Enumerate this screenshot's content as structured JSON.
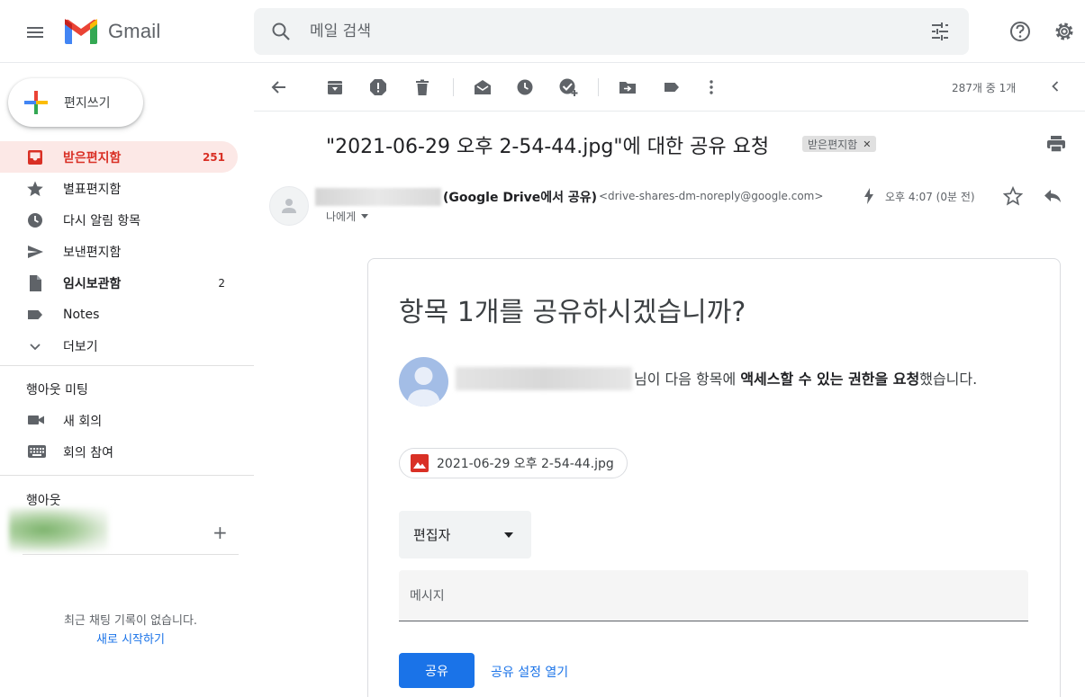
{
  "app": {
    "name": "Gmail"
  },
  "search": {
    "placeholder": "메일 검색"
  },
  "compose": {
    "label": "편지쓰기"
  },
  "sidebar": {
    "items": [
      {
        "label": "받은편지함",
        "count": "251",
        "icon": "inbox-icon"
      },
      {
        "label": "별표편지함",
        "count": "",
        "icon": "star-icon"
      },
      {
        "label": "다시 알림 항목",
        "count": "",
        "icon": "clock-icon"
      },
      {
        "label": "보낸편지함",
        "count": "",
        "icon": "send-icon"
      },
      {
        "label": "임시보관함",
        "count": "2",
        "icon": "draft-icon"
      },
      {
        "label": "Notes",
        "count": "",
        "icon": "label-icon"
      },
      {
        "label": "더보기",
        "count": "",
        "icon": "chevron-down-icon"
      }
    ],
    "meet": {
      "title": "행아웃 미팅",
      "items": [
        {
          "label": "새 회의",
          "icon": "video-icon"
        },
        {
          "label": "회의 참여",
          "icon": "keyboard-icon"
        }
      ]
    },
    "hangouts": {
      "title": "행아웃",
      "no_chat": "최근 채팅 기록이 없습니다.",
      "start_new": "새로 시작하기"
    }
  },
  "toolbar": {
    "pager": "287개 중 1개"
  },
  "message": {
    "subject": "\"2021-06-29 오후 2-54-44.jpg\"에 대한 공유 요청",
    "label": "받은편지함",
    "sender_name": "(Google Drive에서 공유)",
    "sender_email": "<drive-shares-dm-noreply@google.com>",
    "to": "나에게",
    "time": "오후 4:07 (0분 전)"
  },
  "card": {
    "title": "항목 1개를 공유하시겠습니까?",
    "request_prefix": "님이 다음 항목에 ",
    "request_bold": "액세스할 수 있는 권한을 요청",
    "request_suffix": "했습니다.",
    "file_name": "2021-06-29 오후 2-54-44.jpg",
    "role": "편집자",
    "message_placeholder": "메시지",
    "share_button": "공유",
    "open_settings": "공유 설정 열기"
  },
  "colors": {
    "accent": "#1a73e8",
    "inbox_active": "#d93025",
    "inbox_active_bg": "#fce8e6"
  }
}
